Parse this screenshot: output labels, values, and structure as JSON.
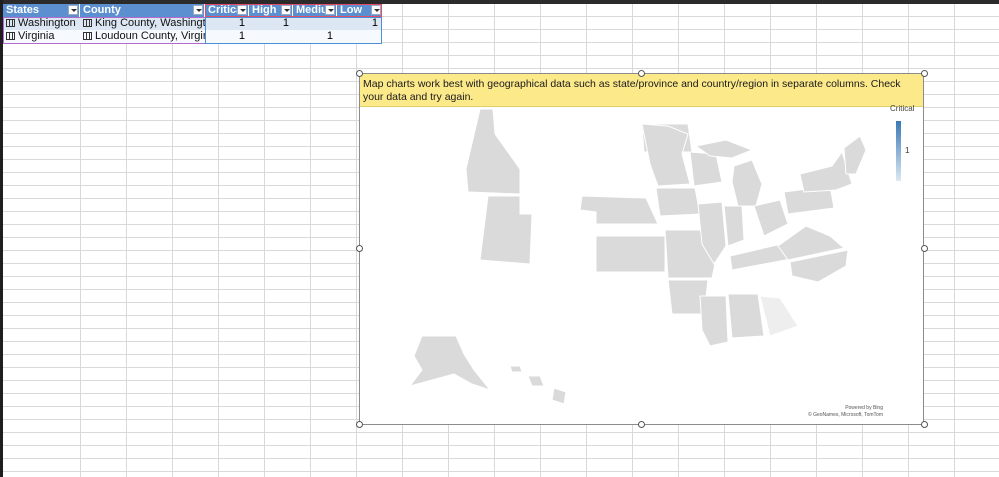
{
  "table": {
    "headers": [
      "States",
      "County",
      "Critical",
      "High",
      "Mediu",
      "Low"
    ],
    "rows": [
      {
        "state": "Washington",
        "county": "King County, Washington",
        "critical": "1",
        "high": "1",
        "medium": "",
        "low": "1"
      },
      {
        "state": "Virginia",
        "county": "Loudoun County, Virginia",
        "critical": "1",
        "high": "",
        "medium": "1",
        "low": ""
      }
    ]
  },
  "chart": {
    "warning": "Map charts work best with geographical data such as state/province and country/region in separate columns. Check your data and try again.",
    "legend_title": "Critical",
    "legend_value": "1",
    "attribution_line1": "Powered by Bing",
    "attribution_line2": "© GeoNames, Microsoft, TomTom"
  },
  "colors": {
    "header_blue": "#5b8fd0",
    "warning_yellow": "#fce98a",
    "map_gray": "#dadada",
    "legend_dark": "#3a78b5"
  }
}
